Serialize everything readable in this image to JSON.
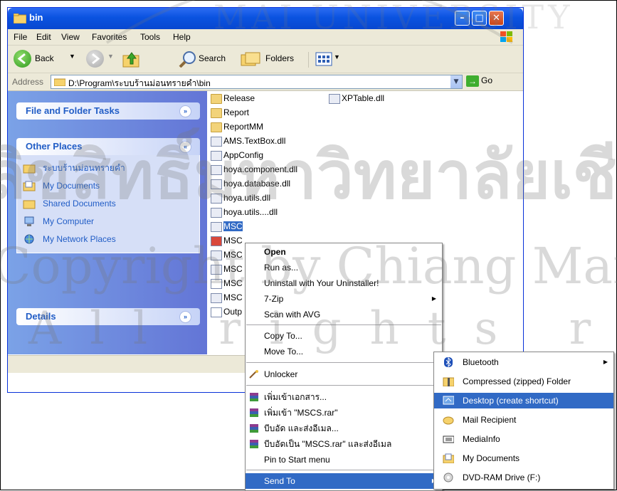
{
  "window": {
    "title": "bin"
  },
  "menu": [
    "File",
    "Edit",
    "View",
    "Favorites",
    "Tools",
    "Help"
  ],
  "toolbar": {
    "back": "Back",
    "search": "Search",
    "folders": "Folders"
  },
  "address": {
    "label": "Address",
    "path": "D:\\Program\\ระบบร้านม่อนทรายคำ\\bin",
    "go": "Go"
  },
  "tasks": {
    "file_folder_tasks": "File and Folder Tasks",
    "other_places": "Other Places",
    "places": [
      "ระบบร้านม่อนทรายคำ",
      "My Documents",
      "Shared Documents",
      "My Computer",
      "My Network Places"
    ],
    "details": "Details"
  },
  "files": {
    "col1": [
      "Release",
      "Report",
      "ReportMM",
      "AMS.TextBox.dll",
      "AppConfig",
      "hoya.component.dll",
      "hoya.database.dll",
      "hoya.utils.dll",
      "hoya.utils....dll",
      "MSC",
      "MSC",
      "MSC",
      "MSC",
      "MSC",
      "MSC",
      "Outp"
    ],
    "col2": [
      "XPTable.dll"
    ]
  },
  "context_menu": {
    "items": [
      "Open",
      "Run as...",
      "Uninstall with Your Uninstaller!",
      "7-Zip",
      "Scan with AVG",
      "Copy To...",
      "Move To...",
      "Unlocker",
      "เพิ่มเข้าเอกสาร...",
      "เพิ่มเข้า \"MSCS.rar\"",
      "บีบอัด และส่งอีเมล...",
      "บีบอัดเป็น \"MSCS.rar\" และส่งอีเมล",
      "Pin to Start menu",
      "Send To"
    ]
  },
  "sendto_menu": {
    "items": [
      "Bluetooth",
      "Compressed (zipped) Folder",
      "Desktop (create shortcut)",
      "Mail Recipient",
      "MediaInfo",
      "My Documents",
      "DVD-RAM Drive (F:)"
    ]
  },
  "watermark": {
    "line1": "ลิขสิทธิ์มหาวิทยาลัยเชียงใหม่",
    "line2": "Copyright by Chiang Mai University",
    "line3": "All rights reserved",
    "seal": "MAI UNIVERSITY"
  },
  "colors": {
    "xp_blue": "#0a53e0",
    "selection": "#316ac5",
    "task_link": "#215dc6"
  }
}
